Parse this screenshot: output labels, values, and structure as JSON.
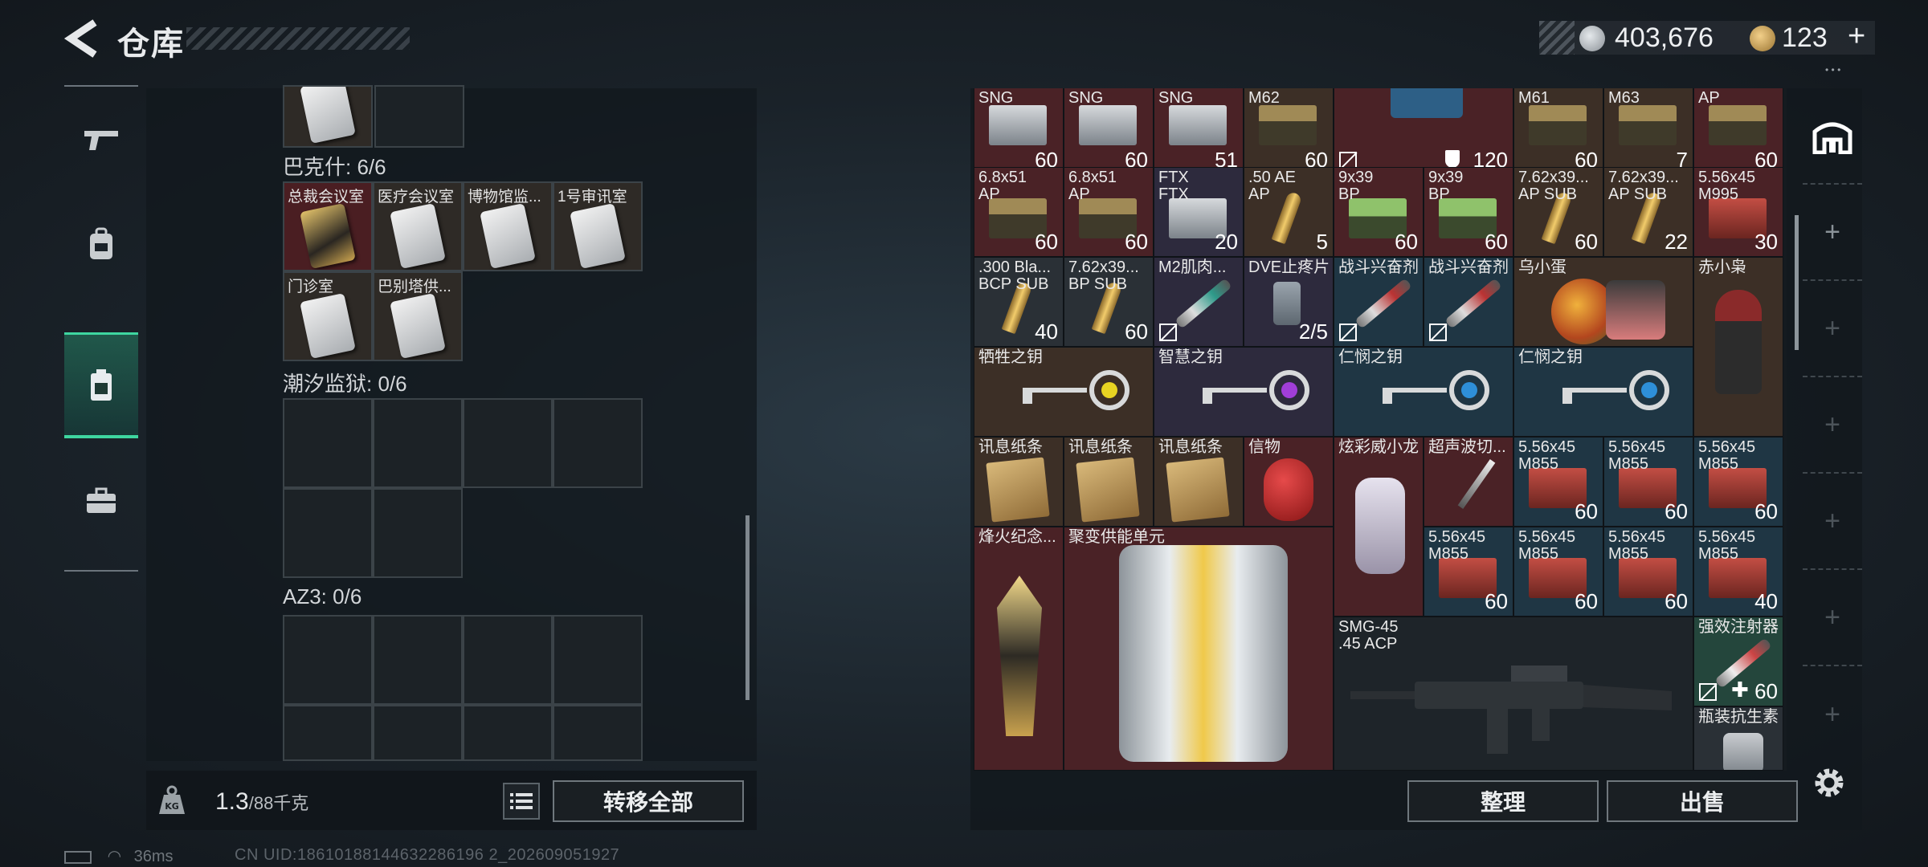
{
  "header": {
    "title": "仓库"
  },
  "currency": {
    "silver": "403,676",
    "gold": "123",
    "add": "+"
  },
  "left_panel": {
    "sections": [
      {
        "label": "巴克什: 6/6",
        "slots": [
          "总裁会议室",
          "医疗会议室",
          "博物馆监...",
          "1号审讯室",
          "门诊室",
          "巴别塔供..."
        ]
      },
      {
        "label": "潮汐监狱: 0/6"
      },
      {
        "label": "AZ3: 0/6"
      }
    ],
    "weight": {
      "current": "1.3",
      "capacity": "/88千克"
    },
    "transfer_all": "转移全部"
  },
  "right_panel": {
    "row0": [
      {
        "name": "SNG",
        "qty": "60"
      },
      {
        "name": "SNG",
        "qty": "60"
      },
      {
        "name": "SNG",
        "qty": "51"
      },
      {
        "name": "M62",
        "qty": "60"
      },
      {
        "name": "",
        "qty": "120"
      },
      {
        "name": "M61",
        "qty": "60"
      },
      {
        "name": "M63",
        "qty": "7"
      },
      {
        "name": "AP",
        "qty": "60"
      }
    ],
    "row1": [
      {
        "l1": "6.8x51",
        "l2": "AP",
        "qty": "60"
      },
      {
        "l1": "6.8x51",
        "l2": "AP",
        "qty": "60"
      },
      {
        "l1": "FTX",
        "l2": "FTX",
        "qty": "20"
      },
      {
        "l1": ".50 AE",
        "l2": "AP",
        "qty": "5"
      },
      {
        "l1": "9x39",
        "l2": "BP",
        "qty": "60"
      },
      {
        "l1": "9x39",
        "l2": "BP",
        "qty": "60"
      },
      {
        "l1": "7.62x39...",
        "l2": "AP SUB",
        "qty": "60"
      },
      {
        "l1": "7.62x39...",
        "l2": "AP SUB",
        "qty": "22"
      },
      {
        "l1": "5.56x45",
        "l2": "M995",
        "qty": "30"
      }
    ],
    "row2": [
      {
        "l1": ".300 Bla...",
        "l2": "BCP SUB",
        "qty": "40"
      },
      {
        "l1": "7.62x39...",
        "l2": "BP SUB",
        "qty": "60"
      },
      {
        "l1": "M2肌肉...",
        "l2": "",
        "qty": ""
      },
      {
        "l1": "DVE止疼片",
        "l2": "",
        "qty": "2/5"
      },
      {
        "l1": "战斗兴奋剂",
        "l2": "",
        "qty": ""
      },
      {
        "l1": "战斗兴奋剂",
        "l2": "",
        "qty": ""
      },
      {
        "l1": "乌小蛋",
        "l2": "",
        "qty": ""
      },
      {
        "l1": "赤小枭",
        "l2": "",
        "qty": ""
      }
    ],
    "keys": [
      "牺牲之钥",
      "智慧之钥",
      "仁悯之钥",
      "仁悯之钥"
    ],
    "row4": [
      {
        "l1": "讯息纸条"
      },
      {
        "l1": "讯息纸条"
      },
      {
        "l1": "讯息纸条"
      },
      {
        "l1": "信物"
      },
      {
        "l1": "炫彩威小龙"
      },
      {
        "l1": "超声波切..."
      },
      {
        "l1": "5.56x45",
        "l2": "M855",
        "qty": "60"
      },
      {
        "l1": "5.56x45",
        "l2": "M855",
        "qty": "60"
      },
      {
        "l1": "5.56x45",
        "l2": "M855",
        "qty": "60"
      }
    ],
    "row5": [
      {
        "l1": "5.56x45",
        "l2": "M855",
        "qty": "60"
      },
      {
        "l1": "5.56x45",
        "l2": "M855",
        "qty": "60"
      },
      {
        "l1": "5.56x45",
        "l2": "M855",
        "qty": "60"
      },
      {
        "l1": "5.56x45",
        "l2": "M855",
        "qty": "40"
      }
    ],
    "torch": "烽火纪念...",
    "fusion": "聚变供能单元",
    "weapon": {
      "l1": "SMG-45",
      "l2": ".45 ACP"
    },
    "injector": {
      "name": "强效注射器",
      "qty": "60"
    },
    "antibiotic": "瓶装抗生素",
    "arrange": "整理",
    "sell": "出售"
  },
  "status": {
    "ping": "36ms",
    "uid": "CN UID:18610188144632286196 2_202609051927"
  },
  "colors": {
    "accent": "#3ed6a0",
    "rarity_red": "#4a2226",
    "rarity_blue": "#1f3644",
    "rarity_gold": "#3c2f26"
  }
}
